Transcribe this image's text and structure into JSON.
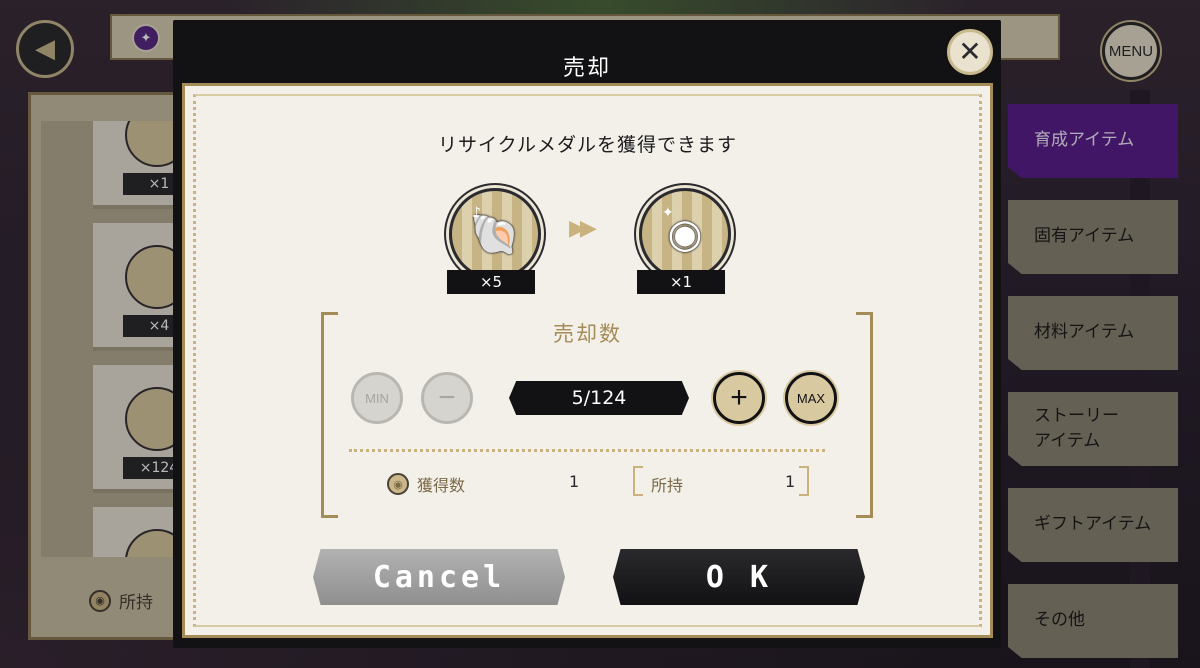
{
  "background": {
    "back_icon": "chevron-left-icon",
    "menu_label": "MENU",
    "gem_icon": "star-icon",
    "left_list": {
      "counts": [
        "×1",
        "×4",
        "×124"
      ],
      "owned_label": "所持"
    },
    "categories": [
      {
        "label": "育成アイテム",
        "active": true
      },
      {
        "label": "固有アイテム",
        "active": false
      },
      {
        "label": "材料アイテム",
        "active": false
      },
      {
        "label": "ストーリーアイテム",
        "lines": [
          "ストーリー",
          "アイテム"
        ],
        "active": false
      },
      {
        "label": "ギフトアイテム",
        "active": false
      },
      {
        "label": "その他",
        "active": false
      }
    ]
  },
  "modal": {
    "title": "売却",
    "close_icon": "close-icon",
    "message": "リサイクルメダルを獲得できます",
    "from_item": {
      "icon": "shell-item-icon",
      "count": "×5"
    },
    "to_item": {
      "icon": "recycle-medal-icon",
      "count": "×1"
    },
    "arrow_icon": "double-chevron-right-icon",
    "sell_section": {
      "title": "売却数",
      "min_label": "MIN",
      "minus_label": "−",
      "quantity": "5/124",
      "plus_label": "+",
      "max_label": "MAX",
      "gain_label": "獲得数",
      "gain_value": "1",
      "owned_label": "所持",
      "owned_value": "1"
    },
    "cancel_label": "Cancel",
    "ok_label": "O K"
  },
  "colors": {
    "accent_gold": "#a38c58",
    "active_tab": "#5b1f8f",
    "modal_dark": "#121113",
    "paper": "#f3f0e9"
  }
}
